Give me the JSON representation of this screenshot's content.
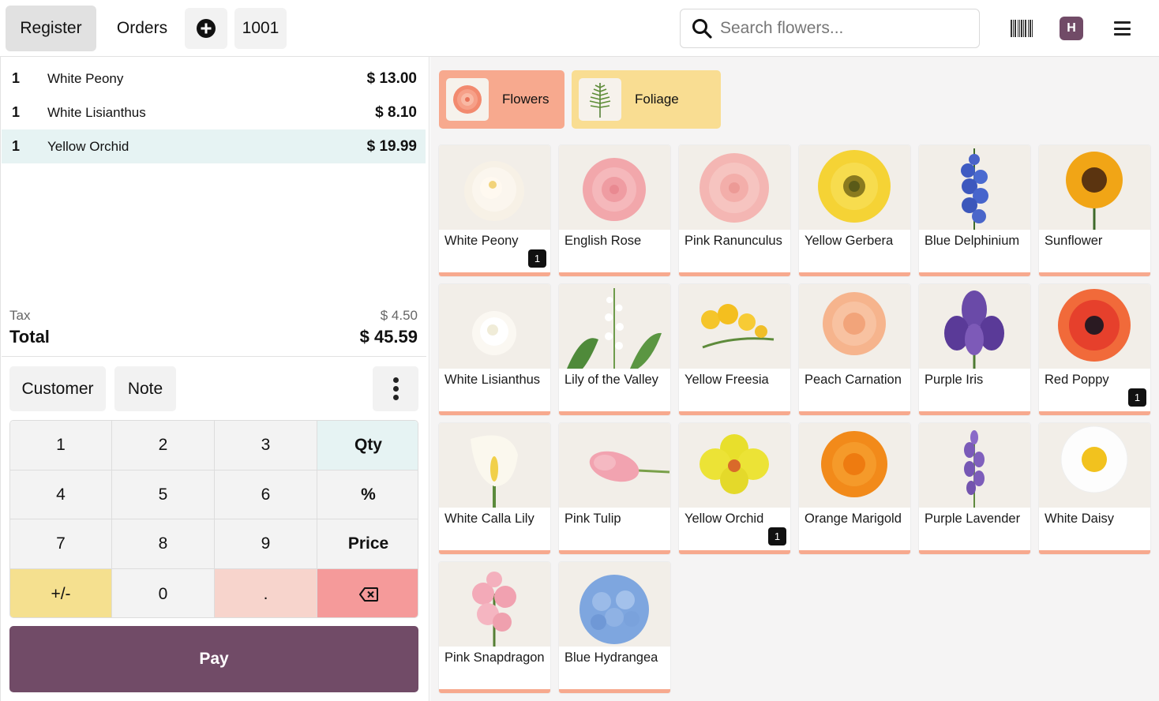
{
  "topbar": {
    "register_label": "Register",
    "orders_label": "Orders",
    "order_number": "1001",
    "search_placeholder": "Search flowers...",
    "avatar_initial": "H"
  },
  "order": {
    "lines": [
      {
        "qty": "1",
        "name": "White Peony",
        "price": "$ 13.00"
      },
      {
        "qty": "1",
        "name": "White Lisianthus",
        "price": "$ 8.10"
      },
      {
        "qty": "1",
        "name": "Yellow Orchid",
        "price": "$ 19.99"
      }
    ],
    "tax_label": "Tax",
    "tax_value": "$ 4.50",
    "total_label": "Total",
    "total_value": "$ 45.59"
  },
  "actions": {
    "customer_label": "Customer",
    "note_label": "Note",
    "pay_label": "Pay"
  },
  "numpad": [
    "1",
    "2",
    "3",
    "Qty",
    "4",
    "5",
    "6",
    "%",
    "7",
    "8",
    "9",
    "Price",
    "+/-",
    "0",
    ".",
    "⌫"
  ],
  "categories": [
    {
      "label": "Flowers",
      "color": "#f7a98e"
    },
    {
      "label": "Foliage",
      "color": "#f9dd92"
    }
  ],
  "products": [
    {
      "name": "White Peony",
      "badge": "1",
      "icon": "peony-image"
    },
    {
      "name": "English Rose",
      "badge": "",
      "icon": "rose-image"
    },
    {
      "name": "Pink Ranunculus",
      "badge": "",
      "icon": "ranunculus-image"
    },
    {
      "name": "Yellow Gerbera",
      "badge": "",
      "icon": "gerbera-image"
    },
    {
      "name": "Blue Delphinium",
      "badge": "",
      "icon": "delphinium-image"
    },
    {
      "name": "Sunflower",
      "badge": "",
      "icon": "sunflower-image"
    },
    {
      "name": "White Lisianthus",
      "badge": "",
      "icon": "lisianthus-image"
    },
    {
      "name": "Lily of the Valley",
      "badge": "",
      "icon": "lily-of-the-valley-image"
    },
    {
      "name": "Yellow Freesia",
      "badge": "",
      "icon": "freesia-image"
    },
    {
      "name": "Peach Carnation",
      "badge": "",
      "icon": "carnation-image"
    },
    {
      "name": "Purple Iris",
      "badge": "",
      "icon": "iris-image"
    },
    {
      "name": "Red Poppy",
      "badge": "1",
      "icon": "poppy-image"
    },
    {
      "name": "White Calla Lily",
      "badge": "",
      "icon": "calla-lily-image"
    },
    {
      "name": "Pink Tulip",
      "badge": "",
      "icon": "tulip-image"
    },
    {
      "name": "Yellow Orchid",
      "badge": "1",
      "icon": "orchid-image"
    },
    {
      "name": "Orange Marigold",
      "badge": "",
      "icon": "marigold-image"
    },
    {
      "name": "Purple Lavender",
      "badge": "",
      "icon": "lavender-image"
    },
    {
      "name": "White Daisy",
      "badge": "",
      "icon": "daisy-image"
    },
    {
      "name": "Pink Snapdragon",
      "badge": "",
      "icon": "snapdragon-image"
    },
    {
      "name": "Blue Hydrangea",
      "badge": "",
      "icon": "hydrangea-image"
    }
  ],
  "colors": {
    "accent": "#714b67",
    "selected_line": "#e6f3f3",
    "flowers_category": "#f7a98e",
    "foliage_category": "#f9dd92"
  }
}
